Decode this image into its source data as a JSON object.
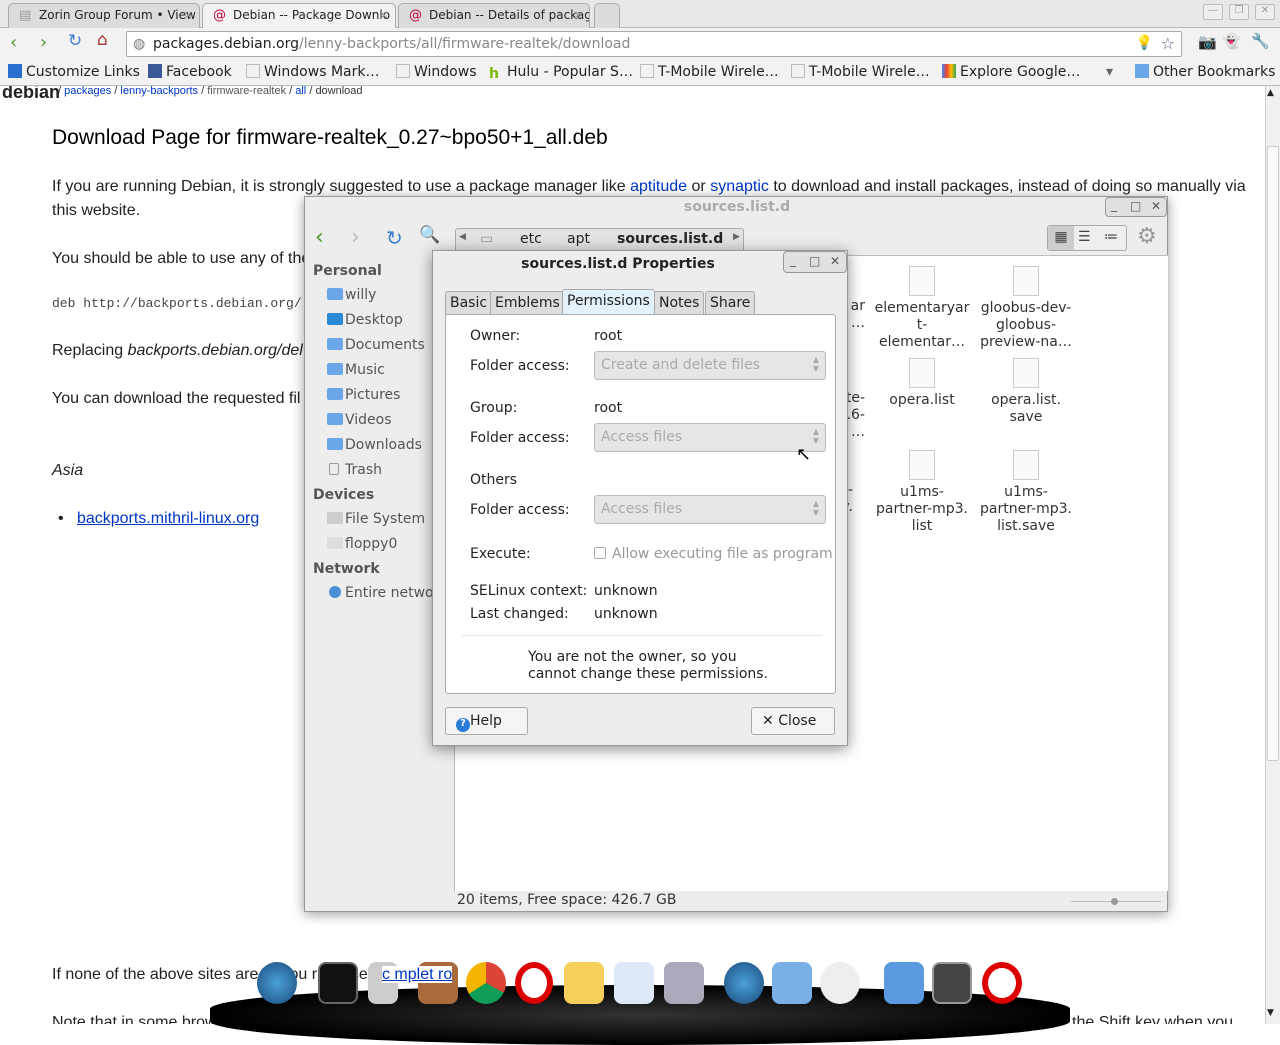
{
  "browser": {
    "tabs": [
      {
        "label": "Zorin Group Forum • View",
        "icon": "page-icon"
      },
      {
        "label": "Debian -- Package Downlo",
        "icon": "debian-swirl-icon"
      },
      {
        "label": "Debian -- Details of packag",
        "icon": "debian-swirl-icon"
      }
    ],
    "url_host": "packages.debian.org",
    "url_path": "/lenny-backports/all/firmware-realtek/download",
    "bookmarks": [
      "Customize Links",
      "Facebook",
      "Windows Mark…",
      "Windows",
      "Hulu - Popular S…",
      "T-Mobile Wirele…",
      "T-Mobile Wirele…",
      "Explore Google…"
    ],
    "other_bookmarks": "Other Bookmarks"
  },
  "page": {
    "logo": "debian",
    "breadcrumb": [
      "packages",
      "lenny-backports",
      "firmware-realtek",
      "all",
      "download"
    ],
    "title": "Download Page for firmware-realtek_0.27~bpo50+1_all.deb",
    "intro_pre": "If you are running Debian, it is strongly suggested to use a package manager like ",
    "aptitude": "aptitude",
    "or": " or ",
    "synaptic": "synaptic",
    "intro_post": " to download and install packages, instead of doing so manually via",
    "intro_line2": "this website.",
    "p_use": "You should be able to use any of the",
    "deb_line": "deb http://backports.debian.org/",
    "replacing": "Replacing ",
    "replacing_it": "backports.debian.org/del",
    "download_from": "You can download the requested fil",
    "region": "Asia",
    "mirror": "backports.mithril-linux.org",
    "none_line": "If none of the above sites are f   enou   r y   pl   se   r ",
    "none_link": "c mplet  ro",
    "note_line": "Note that in some brow",
    "shift_line": "the Shift key when you"
  },
  "nautilus": {
    "title": "sources.list.d",
    "path": [
      "etc",
      "apt",
      "sources.list.d"
    ],
    "sidebar": {
      "personal": "Personal",
      "personal_items": [
        "willy",
        "Desktop",
        "Documents",
        "Music",
        "Pictures",
        "Videos",
        "Downloads",
        "Trash"
      ],
      "devices": "Devices",
      "device_items": [
        "File System",
        "floppy0"
      ],
      "network": "Network",
      "network_items": [
        "Entire network"
      ]
    },
    "files": [
      {
        "name": "elementaryart-elementar…",
        "lines": [
          "elementaryar",
          "t-",
          "elementar…"
        ]
      },
      {
        "name": "gloobus-dev-gloobus-preview-na…",
        "lines": [
          "gloobus-dev-",
          "gloobus-",
          "preview-na…"
        ]
      },
      {
        "name": "opera.list",
        "lines": [
          "opera.list"
        ]
      },
      {
        "name": "opera.list.save",
        "lines": [
          "opera.list.",
          "save"
        ]
      },
      {
        "name": "u1ms-partner-mp3.list",
        "lines": [
          "u1ms-",
          "partner-mp3.",
          "list"
        ]
      },
      {
        "name": "u1ms-partner-mp3.list.save",
        "lines": [
          "u1ms-",
          "partner-mp3.",
          "list.save"
        ]
      }
    ],
    "partial_files": [
      [
        "ar",
        "…"
      ],
      [
        "te-",
        ".6-",
        "…"
      ],
      [
        "-",
        "v."
      ]
    ],
    "status": "20 items, Free space: 426.7 GB"
  },
  "properties": {
    "title": "sources.list.d Properties",
    "tabs": [
      "Basic",
      "Emblems",
      "Permissions",
      "Notes",
      "Share"
    ],
    "active_tab": "Permissions",
    "owner_label": "Owner:",
    "owner": "root",
    "folder_access_label": "Folder access:",
    "owner_access": "Create and delete files",
    "group_label": "Group:",
    "group": "root",
    "group_access": "Access files",
    "others_label": "Others",
    "others_access": "Access files",
    "execute_label": "Execute:",
    "execute_option": "Allow executing file as program",
    "execute_checked": false,
    "selinux_label": "SELinux context:",
    "selinux": "unknown",
    "last_changed_label": "Last changed:",
    "last_changed": "unknown",
    "notice_1": "You are not the owner, so you",
    "notice_2": "cannot change these permissions.",
    "help": "Help",
    "close": "Close"
  },
  "dock": {
    "icons": [
      "navigator",
      "terminal",
      "calculator",
      "photo-viewer",
      "chrome",
      "opera",
      "mail",
      "chat",
      "printer",
      "navigator-2",
      "text-editor",
      "clock-search",
      "downloads-folder",
      "workspace-switcher",
      "power"
    ]
  }
}
